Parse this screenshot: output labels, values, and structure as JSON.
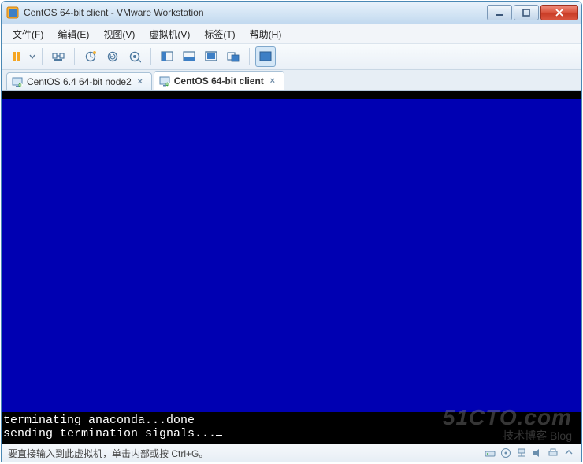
{
  "window": {
    "title": "CentOS 64-bit client - VMware Workstation"
  },
  "menu": {
    "file": "文件(F)",
    "edit": "编辑(E)",
    "view": "视图(V)",
    "vm": "虚拟机(V)",
    "tabs": "标签(T)",
    "help": "帮助(H)"
  },
  "toolbar_icons": {
    "pause": "pause-icon",
    "usb": "usb-icon",
    "snapshot_new": "snapshot-new-icon",
    "snapshot_restore": "snapshot-restore-icon",
    "snapshot_manager": "snapshot-manager-icon",
    "unity": "unity-icon",
    "console": "console-icon",
    "fullscreen": "fullscreen-icon",
    "cycle": "cycle-icon",
    "stretch": "stretch-icon"
  },
  "tabs": [
    {
      "label": "CentOS 6.4 64-bit node2",
      "active": false
    },
    {
      "label": "CentOS 64-bit client",
      "active": true
    }
  ],
  "console": {
    "line1": "terminating anaconda...done",
    "line2": "sending termination signals..."
  },
  "statusbar": {
    "hint": "要直接输入到此虚拟机，单击内部或按 Ctrl+G。"
  },
  "watermark": {
    "main": "51CTO.com",
    "sub": "技术博客   Blog"
  }
}
